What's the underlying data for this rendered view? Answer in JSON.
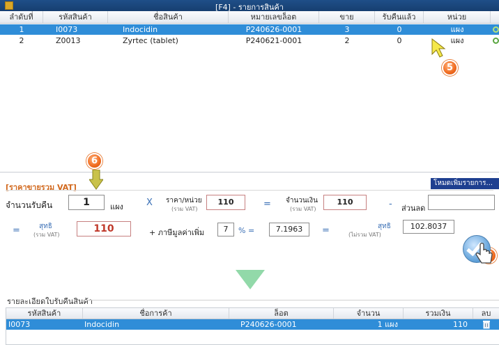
{
  "window": {
    "title": "[F4] - รายการสินค้า"
  },
  "grid": {
    "columns": [
      "ลำดับที่",
      "รหัสสินค้า",
      "ชื่อสินค้า",
      "หมายเลขล็อต",
      "ขาย",
      "รับคืนแล้ว",
      "หน่วย"
    ],
    "rows": [
      {
        "no": "1",
        "code": "I0073",
        "name": "Indocidin",
        "lot": "P240626-0001",
        "sold": "3",
        "returned": "0",
        "unit": "แผง",
        "selected": true
      },
      {
        "no": "2",
        "code": "Z0013",
        "name": "Zyrtec (tablet)",
        "lot": "P240621-0001",
        "sold": "2",
        "returned": "0",
        "unit": "แผง",
        "selected": false
      }
    ]
  },
  "panel": {
    "vat_label": "[ราคาขายรวม VAT]",
    "mode_button": "โหมดเพิ่มรายการ...",
    "qty_label": "จำนวนรับคืน",
    "qty_value": "1",
    "qty_unit": "แผง",
    "op_x": "X",
    "price_label": "ราคา/หน่วย",
    "price_sub": "(รวม VAT)",
    "price_value": "110",
    "op_eq": "=",
    "amount_label": "จำนวนเงิน",
    "amount_sub": "(รวม VAT)",
    "amount_value": "110",
    "op_minus": "-",
    "discount_label": "ส่วนลด",
    "discount_value": "",
    "net_label": "สุทธิ",
    "net_sub": "(รวม VAT)",
    "net_value": "110",
    "vat_text": "+ ภาษีมูลค่าเพิ่ม",
    "vat_rate": "7",
    "percent_eq": "% =",
    "vat_amount": "7.1963",
    "net_ex_label": "สุทธิ",
    "net_ex_sub": "(ไม่รวม VAT)",
    "net_ex_value": "102.8037"
  },
  "markers": {
    "m5": "5",
    "m6": "6",
    "m7": "7"
  },
  "bottom": {
    "title": "รายละเอียดใบรับคืนสินค้า",
    "columns": [
      "รหัสสินค้า",
      "ชื่อการค้า",
      "ล็อต",
      "จำนวน",
      "รวมเงิน",
      "ลบ"
    ],
    "rows": [
      {
        "code": "I0073",
        "name": "Indocidin",
        "lot": "P240626-0001",
        "qty": "1 แผง",
        "total": "110"
      }
    ]
  },
  "colors": {
    "selection": "#2f8dd8",
    "titlebar": "#1f4f88",
    "accent_orange": "#f06b1f",
    "vat_label": "#d2691e"
  }
}
